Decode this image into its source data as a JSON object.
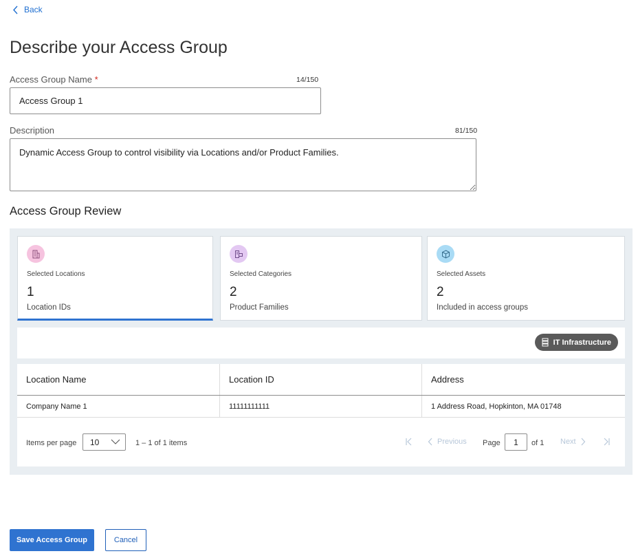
{
  "nav": {
    "back_label": "Back"
  },
  "page": {
    "title": "Describe your Access Group"
  },
  "form": {
    "name_label": "Access Group Name",
    "name_required_mark": "*",
    "name_counter": "14/150",
    "name_value": "Access Group 1",
    "description_label": "Description",
    "description_counter": "81/150",
    "description_value": "Dynamic Access Group to control visibility via Locations and/or Product Families."
  },
  "review": {
    "title": "Access Group Review",
    "cards": [
      {
        "label": "Selected Locations",
        "value": "1",
        "sub": "Location IDs",
        "icon": "building-icon",
        "color": "#f6c3df"
      },
      {
        "label": "Selected Categories",
        "value": "2",
        "sub": "Product Families",
        "icon": "category-icon",
        "color": "#e3c8f2"
      },
      {
        "label": "Selected Assets",
        "value": "2",
        "sub": "Included in access groups",
        "icon": "cube-icon",
        "color": "#a9dbf5"
      }
    ],
    "filter_chip": {
      "label": "IT Infrastructure",
      "icon": "server-icon"
    }
  },
  "table": {
    "headers": [
      "Location Name",
      "Location ID",
      "Address"
    ],
    "rows": [
      [
        "Company Name 1",
        "11111111111",
        "1 Address Road, Hopkinton, MA 01748"
      ]
    ]
  },
  "pagination": {
    "items_per_page_label": "Items per page",
    "items_per_page_value": "10",
    "range_text": "1 – 1 of 1 items",
    "previous_label": "Previous",
    "next_label": "Next",
    "page_label": "Page",
    "page_value": "1",
    "of_label": "of 1"
  },
  "actions": {
    "save_label": "Save Access Group",
    "cancel_label": "Cancel"
  },
  "colors": {
    "primary": "#2f73d0",
    "panel_bg": "#e9eef2",
    "required": "#d0281d"
  }
}
